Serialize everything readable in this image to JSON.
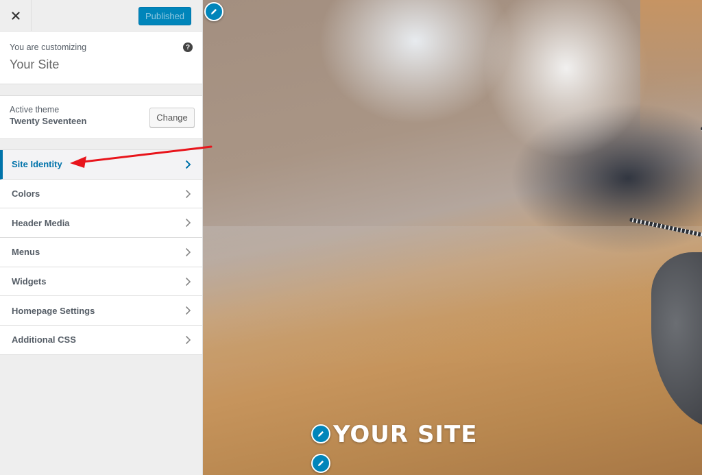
{
  "sidebar": {
    "close_label": "×",
    "publish_label": "Published",
    "customizing": {
      "label": "You are customizing",
      "site_name": "Your Site",
      "help_glyph": "?"
    },
    "theme": {
      "label": "Active theme",
      "name": "Twenty Seventeen",
      "change_label": "Change"
    },
    "menu": [
      {
        "label": "Site Identity",
        "active": true
      },
      {
        "label": "Colors",
        "active": false
      },
      {
        "label": "Header Media",
        "active": false
      },
      {
        "label": "Menus",
        "active": false
      },
      {
        "label": "Widgets",
        "active": false
      },
      {
        "label": "Homepage Settings",
        "active": false
      },
      {
        "label": "Additional CSS",
        "active": false
      }
    ]
  },
  "preview": {
    "site_title": "YOUR SITE"
  },
  "colors": {
    "accent": "#0073aa",
    "publish_bg": "#0085ba",
    "annotation_arrow": "#e8141b"
  }
}
